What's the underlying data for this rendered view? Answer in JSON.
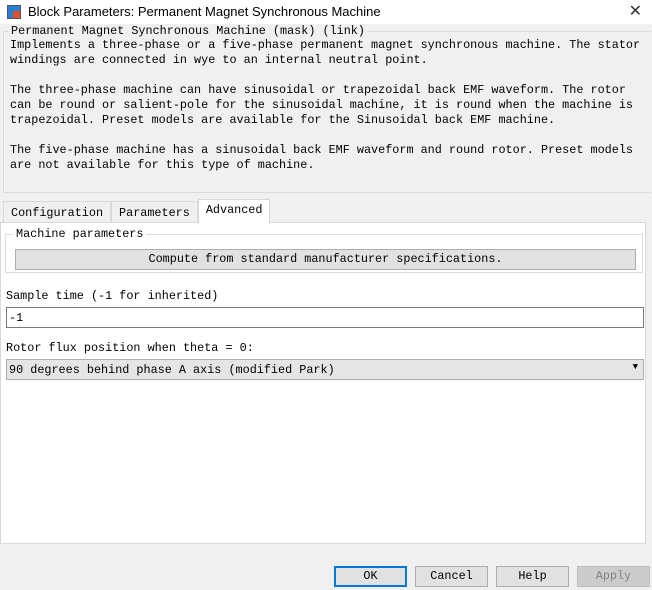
{
  "window": {
    "title": "Block Parameters: Permanent Magnet Synchronous Machine",
    "close_icon": "close-icon"
  },
  "description": {
    "legend": "Permanent Magnet Synchronous Machine (mask) (link)",
    "paragraphs": [
      "Implements a three-phase or a five-phase permanent magnet synchronous machine. The stator\nwindings are connected in wye to an internal neutral point.",
      "The three-phase machine can have sinusoidal or trapezoidal back EMF waveform. The rotor\ncan be round or salient-pole for the sinusoidal machine, it is round when the machine is\ntrapezoidal. Preset models are available for the Sinusoidal back EMF machine.",
      "The five-phase machine has a sinusoidal back EMF waveform and round rotor. Preset models\nare not available for this type of machine."
    ]
  },
  "tabs": [
    {
      "label": "Configuration"
    },
    {
      "label": "Parameters"
    },
    {
      "label": "Advanced",
      "active": true
    }
  ],
  "advanced": {
    "machine_parameters_legend": "Machine parameters",
    "compute_button": "Compute from standard manufacturer specifications.",
    "sample_time_label": "Sample time (-1 for inherited)",
    "sample_time_value": "-1",
    "rotor_flux_label": "Rotor flux position when theta = 0:",
    "rotor_flux_value": "90 degrees behind phase A axis (modified Park)"
  },
  "buttons": {
    "ok": "OK",
    "cancel": "Cancel",
    "help": "Help",
    "apply": "Apply"
  },
  "colors": {
    "focus": "#0078d7"
  }
}
